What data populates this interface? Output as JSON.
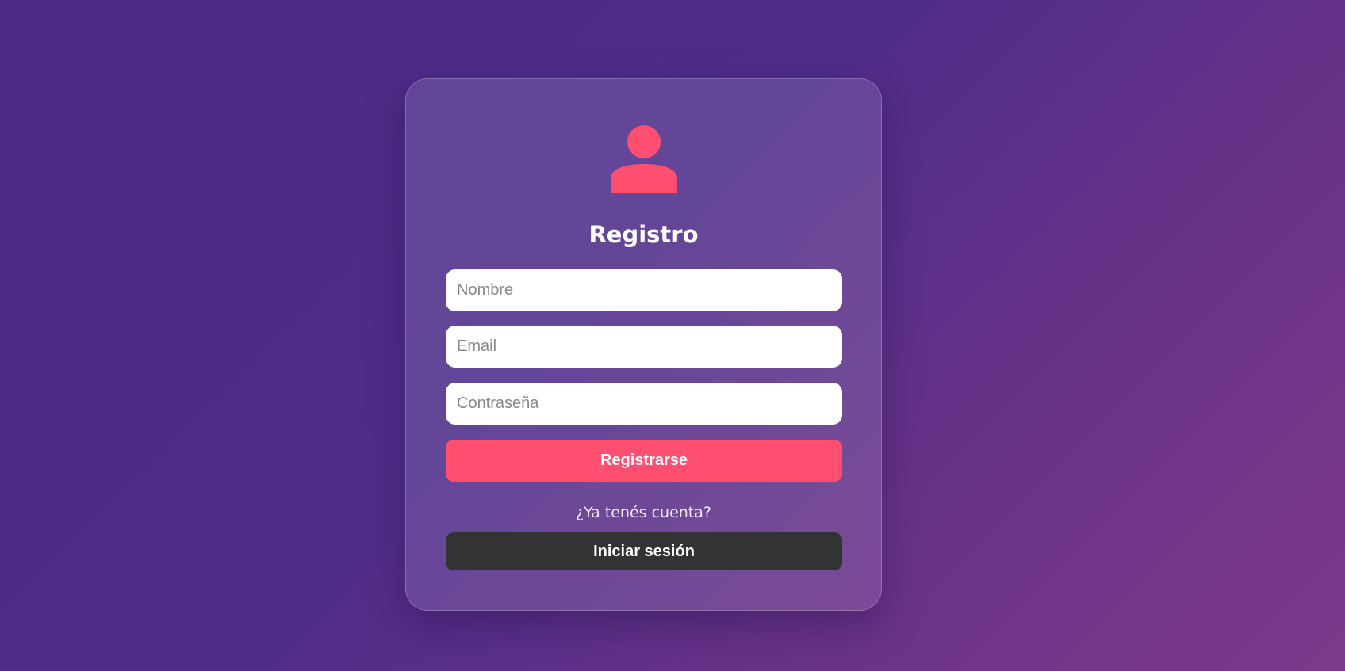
{
  "colors": {
    "accent": "#ff4f70",
    "secondary_button": "#333333",
    "background_start": "#4a2a86",
    "background_end": "#7d3a8a"
  },
  "form": {
    "icon": "user-icon",
    "title": "Registro",
    "name_field": {
      "placeholder": "Nombre",
      "value": ""
    },
    "email_field": {
      "placeholder": "Email",
      "value": ""
    },
    "password_field": {
      "placeholder": "Contraseña",
      "value": ""
    },
    "register_label": "Registrarse",
    "login_prompt": "¿Ya tenés cuenta?",
    "login_label": "Iniciar sesión"
  }
}
